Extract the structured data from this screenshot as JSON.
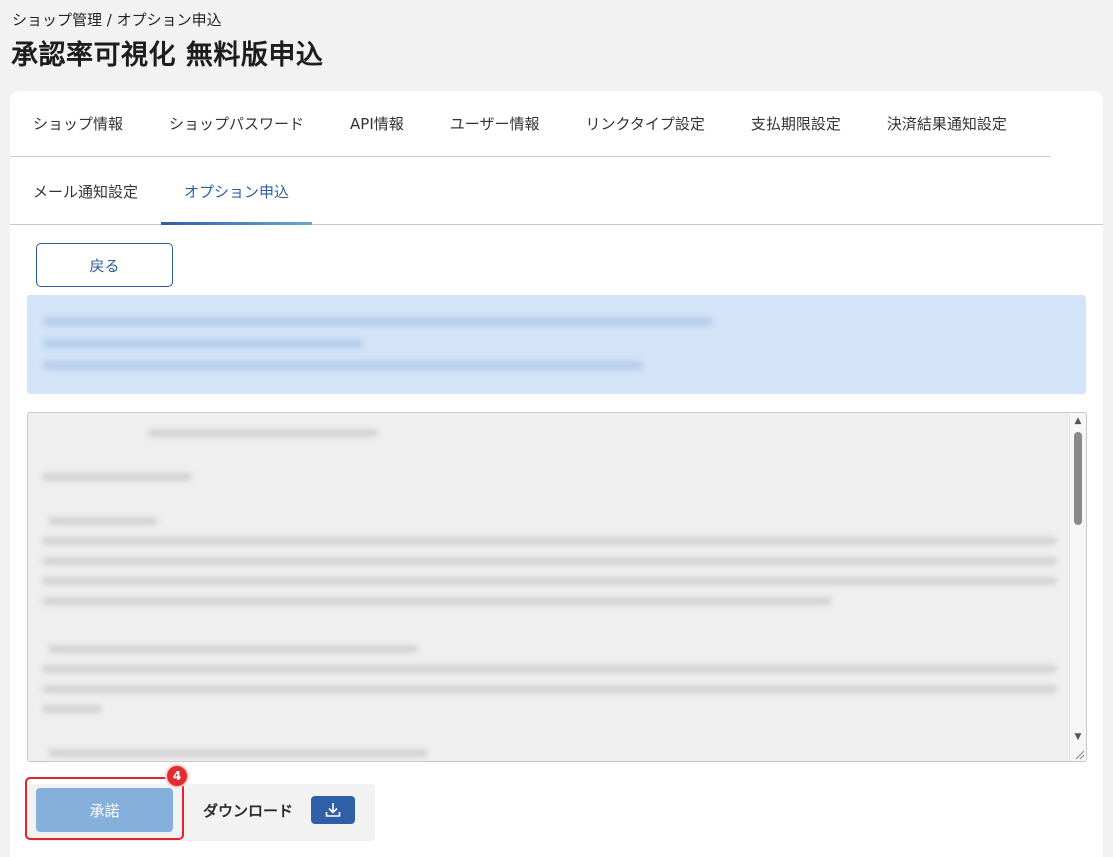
{
  "header": {
    "breadcrumb": "ショップ管理 / オプション申込",
    "title": "承認率可視化 無料版申込"
  },
  "tabs": {
    "row1": [
      "ショップ情報",
      "ショップパスワード",
      "API情報",
      "ユーザー情報",
      "リンクタイプ設定",
      "支払期限設定",
      "決済結果通知設定"
    ],
    "row2": [
      "メール通知設定",
      "オプション申込"
    ],
    "active": "オプション申込"
  },
  "buttons": {
    "back_label": "戻る",
    "accept_label": "承諾",
    "download_label": "ダウンロード"
  },
  "annotation": {
    "step_number": "4"
  },
  "colors": {
    "accent": "#2f5fa7",
    "accept_disabled": "#86b0dc",
    "info_bg": "#d3e4f8",
    "highlight": "#e3232b"
  },
  "icons": {
    "download": "download-tray-icon",
    "scroll_up": "triangle-up-icon",
    "scroll_down": "triangle-down-icon",
    "resize": "resize-grip-icon"
  }
}
